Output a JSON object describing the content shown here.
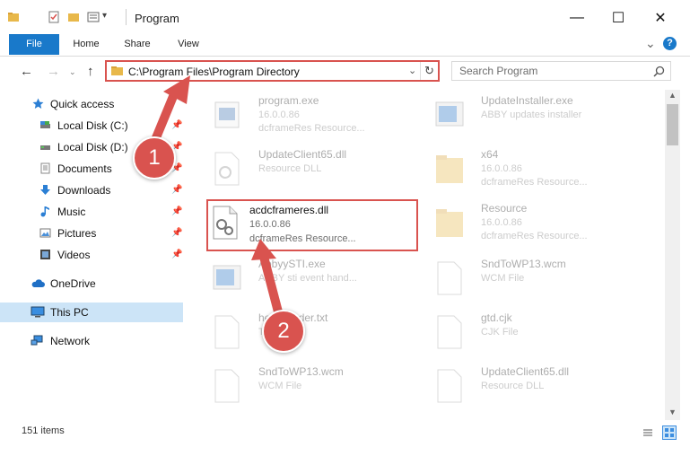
{
  "window": {
    "title": "Program",
    "minimize": "—",
    "maximize": "☐",
    "close": "✕"
  },
  "ribbon": {
    "tabs": [
      "File",
      "Home",
      "Share",
      "View"
    ],
    "expand": "⌄",
    "help": "?"
  },
  "nav": {
    "back": "←",
    "forward": "→",
    "up": "↑",
    "address": "C:\\Program Files\\Program Directory",
    "search_placeholder": "Search Program"
  },
  "sidebar": {
    "items": [
      {
        "label": "Quick access",
        "icon": "star-icon"
      },
      {
        "label": "Local Disk (C:)",
        "icon": "drive-icon"
      },
      {
        "label": "Local Disk (D:)",
        "icon": "drive-icon"
      },
      {
        "label": "Documents",
        "icon": "documents-icon"
      },
      {
        "label": "Downloads",
        "icon": "downloads-icon"
      },
      {
        "label": "Music",
        "icon": "music-icon"
      },
      {
        "label": "Pictures",
        "icon": "pictures-icon"
      },
      {
        "label": "Videos",
        "icon": "videos-icon"
      },
      {
        "label": "OneDrive",
        "icon": "cloud-icon"
      },
      {
        "label": "This PC",
        "icon": "computer-icon"
      },
      {
        "label": "Network",
        "icon": "network-icon"
      }
    ]
  },
  "files": [
    {
      "name": "program.exe",
      "line1": "16.0.0.86",
      "line2": "dcframeRes Resource..."
    },
    {
      "name": "UpdateInstaller.exe",
      "line1": "ABBY updates installer",
      "line2": ""
    },
    {
      "name": "UpdateClient65.dll",
      "line1": "Resource DLL",
      "line2": ""
    },
    {
      "name": "x64",
      "line1": "16.0.0.86",
      "line2": "dcframeRes Resource..."
    },
    {
      "name": "acdcframeres.dll",
      "line1": "16.0.0.86",
      "line2": "dcframeRes Resource..."
    },
    {
      "name": "Resource",
      "line1": "16.0.0.86",
      "line2": "dcframeRes Resource..."
    },
    {
      "name": "AbbyySTI.exe",
      "line1": "ABBY sti event hand...",
      "line2": ""
    },
    {
      "name": "SndToWP13.wcm",
      "line1": "WCM File",
      "line2": ""
    },
    {
      "name": "helpReader.txt",
      "line1": "TXT",
      "line2": ""
    },
    {
      "name": "gtd.cjk",
      "line1": "CJK File",
      "line2": ""
    },
    {
      "name": "SndToWP13.wcm",
      "line1": "WCM File",
      "line2": ""
    },
    {
      "name": "UpdateClient65.dll",
      "line1": "Resource DLL",
      "line2": ""
    }
  ],
  "status": {
    "items_count": "151 items"
  },
  "callouts": {
    "one": "1",
    "two": "2"
  },
  "colors": {
    "accent": "#1979ca",
    "highlight": "#d9534f",
    "selected": "#cce4f7"
  }
}
